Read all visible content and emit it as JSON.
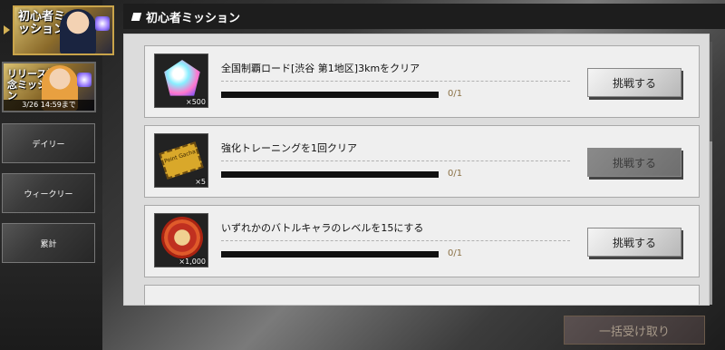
{
  "header": {
    "title": "初心者ミッション"
  },
  "sidebar": {
    "beginner_tab": {
      "title": "初心者ミッション"
    },
    "release_tab": {
      "title": "リリース記念ミッション",
      "deadline": "3/26 14:59まで"
    },
    "items": [
      {
        "label": "デイリー"
      },
      {
        "label": "ウィークリー"
      },
      {
        "label": "累計"
      }
    ]
  },
  "missions": [
    {
      "title": "全国制覇ロード[渋谷 第1地区]3kmをクリア",
      "reward_qty": "×500",
      "reward_icon": "gem-icon",
      "progress": "0/1",
      "progress_fraction": 0,
      "button": "挑戦する",
      "enabled": true
    },
    {
      "title": "強化トレーニングを1回クリア",
      "reward_qty": "×5",
      "reward_icon": "gacha-ticket-icon",
      "reward_text": "Point Gacha",
      "progress": "0/1",
      "progress_fraction": 0,
      "button": "挑戦する",
      "enabled": false
    },
    {
      "title": "いずれかのバトルキャラのレベルを15にする",
      "reward_qty": "×1,000",
      "reward_icon": "medal-icon",
      "progress": "0/1",
      "progress_fraction": 0,
      "button": "挑戦する",
      "enabled": true
    }
  ],
  "footer": {
    "claim_all_label": "一括受け取り"
  },
  "colors": {
    "accent_gold": "#c9a44a",
    "progress_text": "#8a7044"
  }
}
